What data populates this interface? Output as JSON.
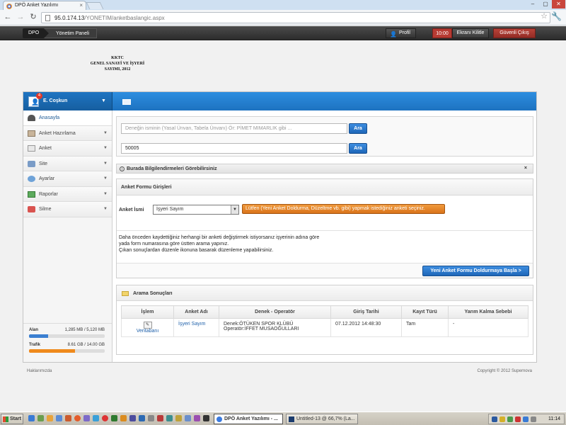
{
  "browser": {
    "tab_title": "DPÖ Anket Yazılımı",
    "url_host": "95.0.174.13",
    "url_path": "/YONETIM/anketbaslangic.aspx"
  },
  "topbar": {
    "home_crumb": "DPO",
    "panel_crumb": "Yönetim Paneli",
    "profile_label": "Profil",
    "timer": "10:00",
    "lock_label": "Ekranı Kilitle",
    "logout_label": "Güvenli Çıkış"
  },
  "logo": {
    "line1": "KKTC",
    "line2": "GENEL SANAYİ VE İŞYERİ",
    "line3": "SAYIMI, 2012"
  },
  "user": {
    "name": "E. Coşkun",
    "badge_count": "4"
  },
  "sidebar": {
    "items": [
      {
        "label": "Anasayfa",
        "icon": "home-icon"
      },
      {
        "label": "Anket Hazırlama",
        "icon": "form-icon"
      },
      {
        "label": "Anket",
        "icon": "survey-icon"
      },
      {
        "label": "Site",
        "icon": "site-icon"
      },
      {
        "label": "Ayarlar",
        "icon": "settings-icon"
      },
      {
        "label": "Raporlar",
        "icon": "reports-icon"
      },
      {
        "label": "Silme",
        "icon": "delete-icon"
      }
    ],
    "stats": [
      {
        "label": "Alan",
        "value": "1,285 MB / 5,120 MB",
        "fill": 0.25,
        "color": "#3b7fd1"
      },
      {
        "label": "Trafik",
        "value": "8.61 GB / 14.00 GB",
        "fill": 0.61,
        "color": "#ef8a1c"
      }
    ]
  },
  "search": {
    "name_placeholder": "Deneğin isminin (Yasal Ünvan, Tabela Ünvanı) Ör: PİMET MIMARLIK gibi ...",
    "number_value": "50005",
    "button_label": "Ara"
  },
  "info": {
    "text": "Burada Bilgilendirmeleri Görebilirsiniz",
    "close": "×"
  },
  "form": {
    "title": "Anket Formu Girişleri",
    "field_label": "Anket İsmi",
    "selected": "İşyeri Sayım",
    "hint": "Lütfen (Yeni Anket Doldurma, Düzeltme vb. gibi) yapmak istediğiniz anketi seçiniz.",
    "help_lines": [
      "Daha önceden kaydettiğiniz herhangi bir anketi değiştirmek istiyorsanız işyerinin adına göre",
      "yada form numarasına göre üstten arama yapınız.",
      "Çıkan sonuçlardan düzenle ikonuna basarak düzenleme yapabilirsiniz."
    ],
    "start_button": "Yeni Anket Formu Doldurmaya Başla  >"
  },
  "results": {
    "title": "Arama Sonuçları",
    "columns": [
      "İşlem",
      "Anket Adı",
      "Denek - Operatör",
      "Giriş Tarihi",
      "Kayıt Türü",
      "Yarım Kalma Sebebi"
    ],
    "rows": [
      {
        "edit_link": "Veritabanı",
        "survey": "İşyeri Sayım",
        "denek": "Denek:ÖTÜKEN SPOR KLÜBÜ",
        "operator": "Operatör:İFFET MUSAOĞULLARI",
        "date": "07.12.2012 14:48:30",
        "type": "Tam",
        "reason": "-"
      }
    ]
  },
  "footer": {
    "left": "Haklarımızda",
    "right": "Copyright © 2012 Supernova"
  },
  "taskbar": {
    "start": "Start",
    "tasks": [
      {
        "label": "DPÖ Anket Yazılımı - ...",
        "active": true
      },
      {
        "label": "Untitled-13 @ 66,7% (La...",
        "active": false
      }
    ],
    "clock": "11:14"
  }
}
